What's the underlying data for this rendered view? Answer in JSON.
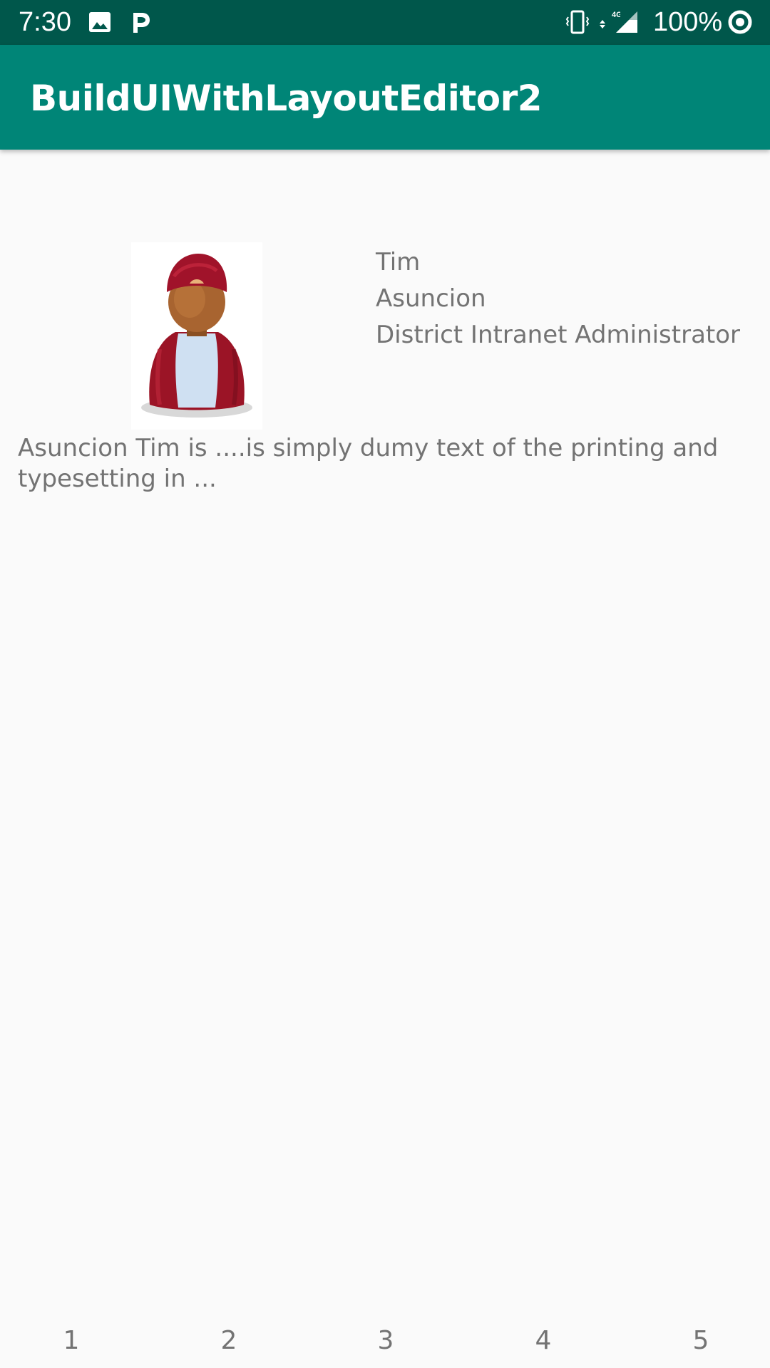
{
  "status_bar": {
    "time": "7:30",
    "battery": "100%",
    "icons": [
      "image-icon",
      "parking-icon",
      "vibrate-icon",
      "data-4g-icon",
      "signal-icon",
      "sync-icon"
    ],
    "background": "#00574b"
  },
  "app_bar": {
    "title": "BuildUIWithLayoutEditor2",
    "background": "#008577"
  },
  "profile": {
    "avatar_icon": "user-avatar-icon",
    "first_name": "Tim",
    "last_name": "Asuncion",
    "role": "District Intranet Administrator",
    "bio": "Asuncion Tim is ....is simply dumy text of the printing and typesetting in ..."
  },
  "pager": {
    "items": [
      "1",
      "2",
      "3",
      "4",
      "5"
    ]
  }
}
